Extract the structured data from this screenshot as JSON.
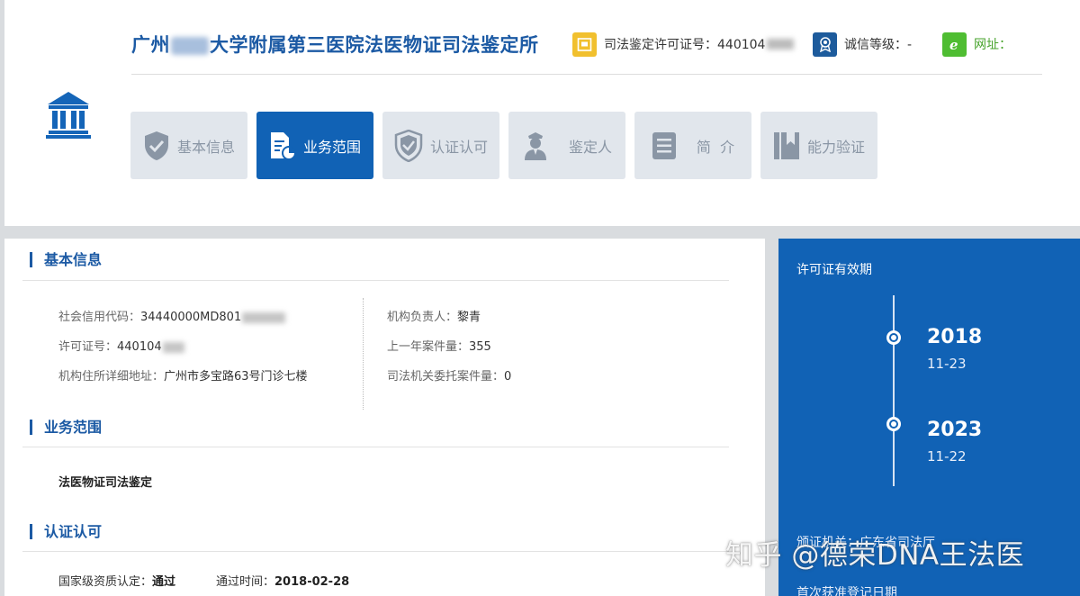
{
  "header": {
    "org_title_prefix": "广州",
    "org_title_suffix": "大学附属第三医院法医物证司法鉴定所",
    "license_label": "司法鉴定许可证号：440104",
    "credit_label": "诚信等级：-",
    "website_label": "网址："
  },
  "tabs": [
    {
      "label": "基本信息",
      "icon": "shield-check-icon",
      "active": false
    },
    {
      "label": "业务范围",
      "icon": "document-chart-icon",
      "active": true
    },
    {
      "label": "认证认可",
      "icon": "certified-shield-icon",
      "active": false
    },
    {
      "label": "鉴定人",
      "icon": "person-icon",
      "active": false
    },
    {
      "label": "简  介",
      "icon": "document-list-icon",
      "active": false
    },
    {
      "label": "能力验证",
      "icon": "bookmark-book-icon",
      "active": false
    }
  ],
  "basic_info": {
    "section_title": "基本信息",
    "credit_code_label": "社会信用代码：",
    "credit_code_value": "34440000MD801",
    "license_no_label": "许可证号：",
    "license_no_value": "440104",
    "address_label": "机构住所详细地址：",
    "address_value": "广州市多宝路63号门诊七楼",
    "head_label": "机构负责人：",
    "head_value": "黎青",
    "last_year_cases_label": "上一年案件量：",
    "last_year_cases_value": "355",
    "judicial_cases_label": "司法机关委托案件量：",
    "judicial_cases_value": "0"
  },
  "business_scope": {
    "section_title": "业务范围",
    "item": "法医物证司法鉴定"
  },
  "certification": {
    "section_title": "认证认可",
    "national_label": "国家级资质认定：",
    "national_value": "通过",
    "pass_time_label": "通过时间：",
    "pass_time_value": "2018-02-28"
  },
  "side_panel": {
    "title": "许可证有效期",
    "start_year": "2018",
    "start_date": "11-23",
    "end_year": "2023",
    "end_date": "11-22",
    "issuer_label": "颁证机关：广东省司法厅",
    "first_reg_label": "首次获准登记日期"
  },
  "watermark": "知乎 @德荣DNA王法医",
  "colors": {
    "brand_blue": "#1162b5",
    "title_blue": "#1c5aa4",
    "tab_inactive": "#e1e6ec"
  }
}
